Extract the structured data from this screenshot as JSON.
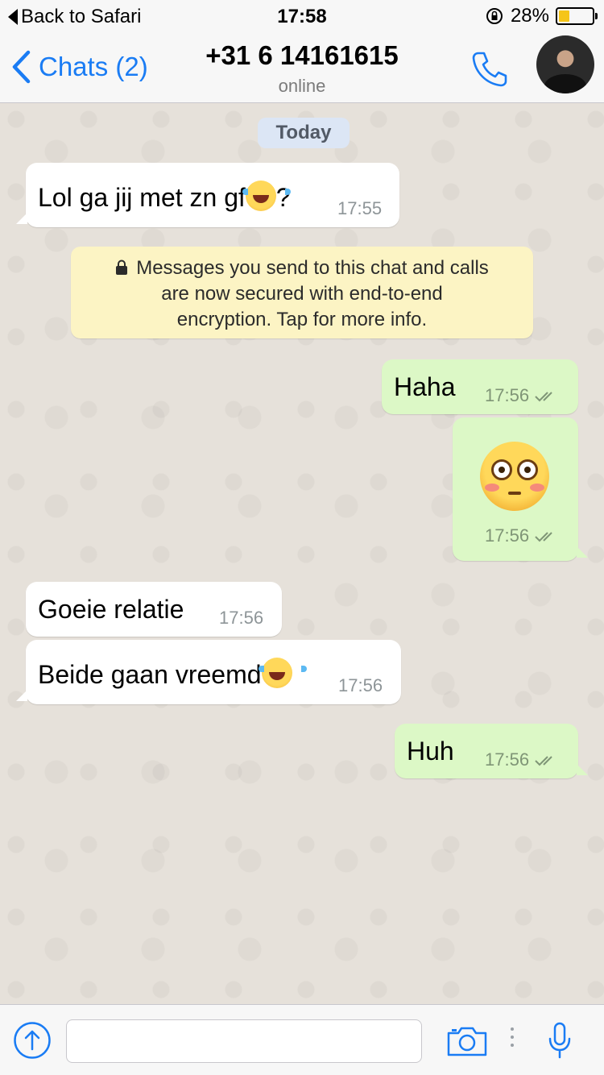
{
  "status_bar": {
    "back_label": "Back to Safari",
    "time": "17:58",
    "battery": "28%",
    "battery_level": 0.28
  },
  "nav": {
    "back_label": "Chats (2)",
    "title": "+31 6 14161615",
    "subtitle": "online",
    "icons": [
      "chevron-left-icon",
      "phone-icon",
      "avatar"
    ]
  },
  "chat": {
    "date_label": "Today",
    "encryption_notice": {
      "line1": "Messages you send to this chat and calls",
      "line2": "are now secured with end-to-end",
      "line3": "encryption. Tap for more info."
    },
    "messages": [
      {
        "direction": "in",
        "text": "Lol ga jij met zn gf",
        "emoji_after": "face-with-tears-of-joy",
        "suffix": "?",
        "time": "17:55"
      },
      {
        "direction": "out",
        "text": "Haha",
        "time": "17:56",
        "read": true
      },
      {
        "direction": "out",
        "emoji": "flushed-face",
        "time": "17:56",
        "read": true
      },
      {
        "direction": "in",
        "text": "Goeie relatie",
        "time": "17:56"
      },
      {
        "direction": "in",
        "text": "Beide gaan vreemd",
        "emoji_after": "face-with-tears-of-joy",
        "time": "17:56"
      },
      {
        "direction": "out",
        "text": "Huh",
        "time": "17:56",
        "read": true
      }
    ]
  },
  "input_bar": {
    "placeholder": "",
    "icons": [
      "upload-icon",
      "camera-icon",
      "more-dots-icon",
      "microphone-icon"
    ]
  },
  "colors": {
    "accent": "#1a7cf4",
    "incoming_bubble": "#ffffff",
    "outgoing_bubble": "#dcf8c6",
    "chat_background": "#e6e1da",
    "notice_background": "#fcf4c4",
    "date_pill": "#dce6f5"
  }
}
